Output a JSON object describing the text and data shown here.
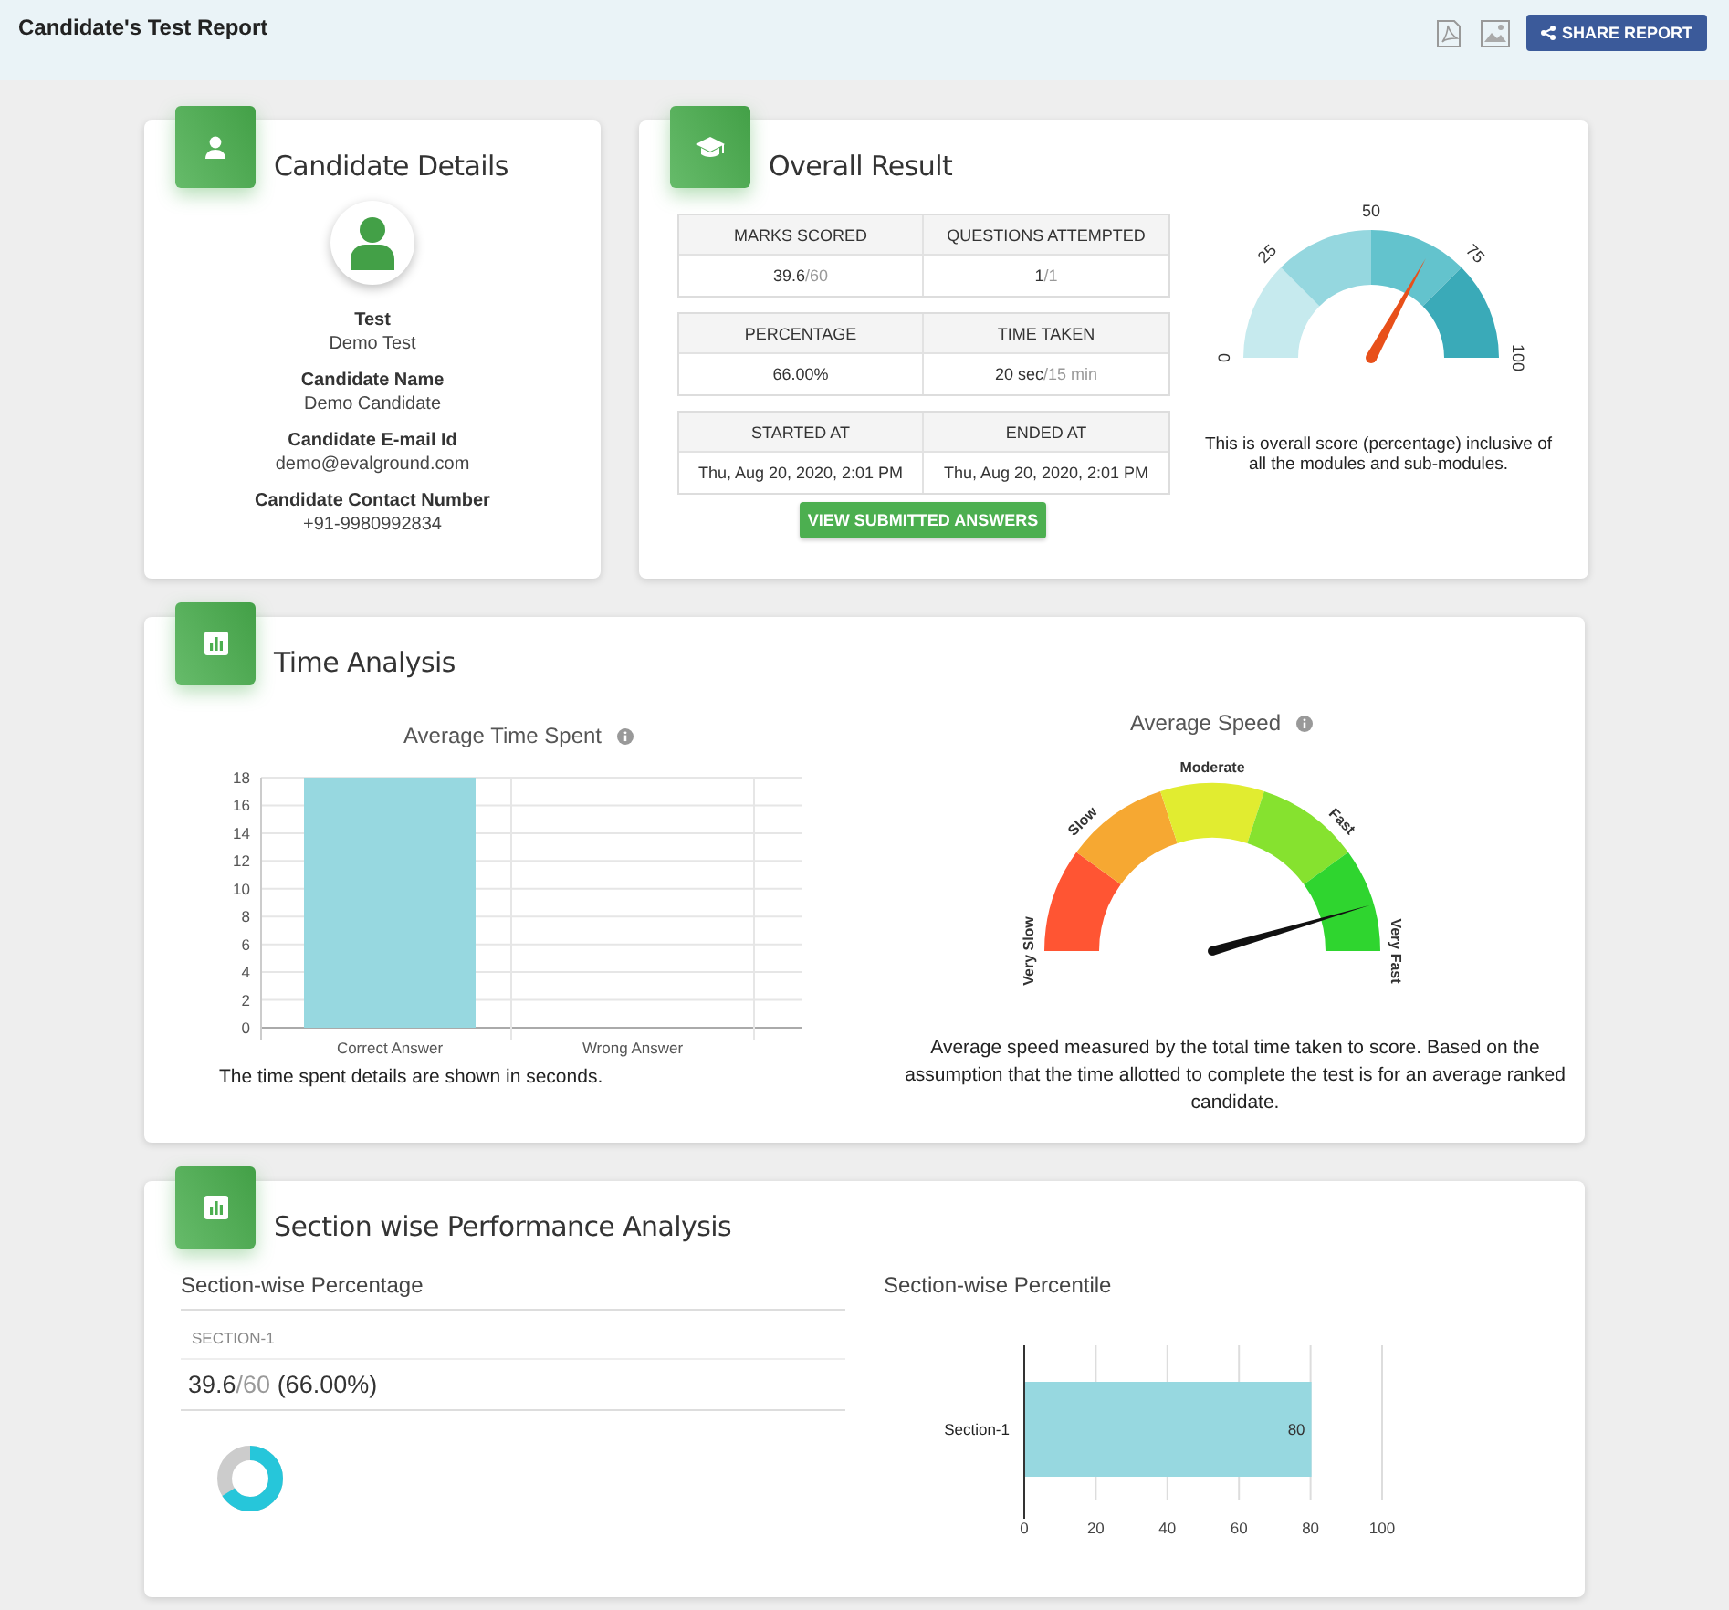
{
  "header": {
    "title": "Candidate's Test Report",
    "share_button": "SHARE REPORT"
  },
  "candidate_details": {
    "title": "Candidate Details",
    "fields": [
      {
        "label": "Test",
        "value": "Demo Test"
      },
      {
        "label": "Candidate Name",
        "value": "Demo Candidate"
      },
      {
        "label": "Candidate E-mail Id",
        "value": "demo@evalground.com"
      },
      {
        "label": "Candidate Contact Number",
        "value": "+91-9980992834"
      }
    ]
  },
  "overall_result": {
    "title": "Overall Result",
    "stats": [
      {
        "label": "MARKS SCORED",
        "value": "39.6",
        "total": "/60"
      },
      {
        "label": "QUESTIONS ATTEMPTED",
        "value": "1",
        "total": "/1"
      },
      {
        "label": "PERCENTAGE",
        "value": "66.00%"
      },
      {
        "label": "TIME TAKEN",
        "value": "20 sec ",
        "total": "/15 min"
      },
      {
        "label": "STARTED AT",
        "value": "Thu, Aug 20, 2020, 2:01 PM"
      },
      {
        "label": "ENDED AT",
        "value": "Thu, Aug 20, 2020, 2:01 PM"
      }
    ],
    "button": "VIEW SUBMITTED ANSWERS",
    "gauge": {
      "labels": [
        "0",
        "25",
        "50",
        "75",
        "100"
      ],
      "level": 0.66
    },
    "note": "This is overall score (percentage) inclusive of all the modules and sub-modules."
  },
  "time_analysis": {
    "title": "Time Analysis",
    "chart_title": "Average Time Spent",
    "chart_data": {
      "type": "bar",
      "grid": true,
      "categories": [
        "Correct Answer",
        "Wrong Answer"
      ],
      "values": [
        18,
        0
      ],
      "ylim": [
        0,
        18
      ],
      "yticks": [
        0,
        2,
        4,
        6,
        8,
        10,
        12,
        14,
        16,
        18
      ]
    },
    "chart_note": "The time spent details are shown in seconds.",
    "speed": {
      "title": "Average Speed",
      "labels": [
        "Very Slow",
        "Slow",
        "Moderate",
        "Fast",
        "Very Fast"
      ],
      "level": 0.91
    },
    "speed_note": "Average speed measured by the total time taken to score. Based on the assumption that the time allotted to complete the test is for an average ranked candidate."
  },
  "section_performance": {
    "title": "Section wise Performance Analysis",
    "percentage_title": "Section-wise Percentage",
    "sections": [
      {
        "name": "SECTION-1",
        "score": "39.6",
        "total": "/60",
        "percent": " (66.00%)",
        "level": 0.66
      }
    ],
    "percentile_title": "Section-wise Percentile",
    "chart_data": {
      "type": "bar",
      "orientation": "horizontal",
      "grid": true,
      "categories": [
        "Section-1"
      ],
      "values": [
        80
      ],
      "xlim": [
        0,
        100
      ],
      "xticks": [
        0,
        20,
        40,
        60,
        80,
        100
      ],
      "data_labels": true
    }
  }
}
